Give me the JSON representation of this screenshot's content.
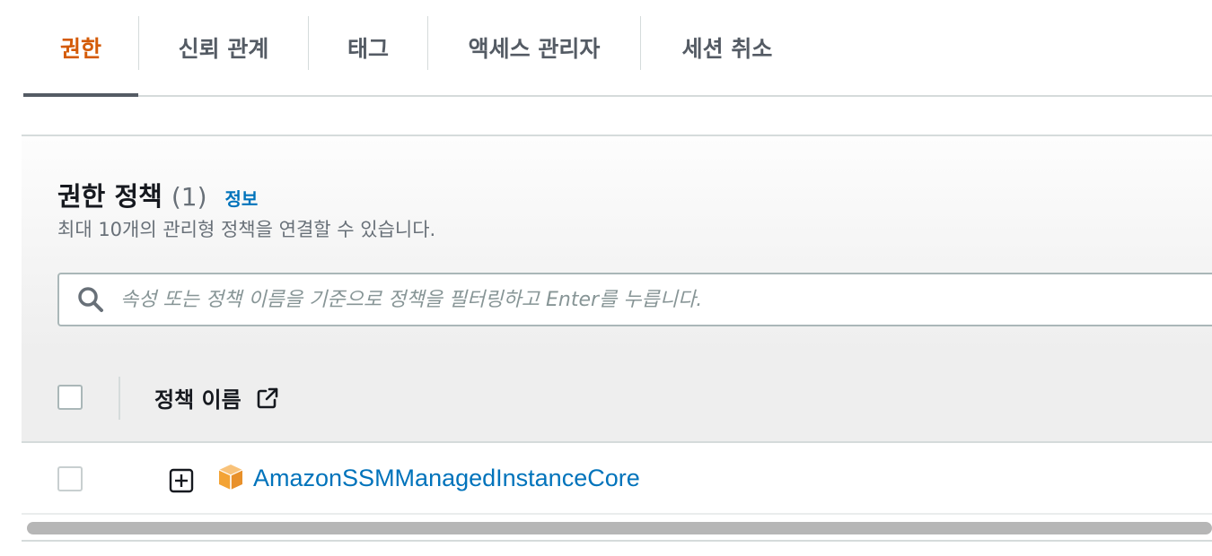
{
  "tabs": [
    {
      "label": "권한",
      "active": true
    },
    {
      "label": "신뢰 관계",
      "active": false
    },
    {
      "label": "태그",
      "active": false
    },
    {
      "label": "액세스 관리자",
      "active": false
    },
    {
      "label": "세션 취소",
      "active": false
    }
  ],
  "panel": {
    "title": "권한 정책",
    "count": "(1)",
    "info_link": "정보",
    "description": "최대 10개의 관리형 정책을 연결할 수 있습니다.",
    "search": {
      "placeholder": "속성 또는 정책 이름을 기준으로 정책을 필터링하고 Enter를 누릅니다.",
      "value": "",
      "icon": "search-icon"
    }
  },
  "table": {
    "columns": [
      {
        "label": "정책 이름",
        "icon": "external-link-icon"
      }
    ],
    "rows": [
      {
        "policy_name": "AmazonSSMManagedInstanceCore",
        "policy_icon": "aws-managed-policy-cube-icon",
        "expand_icon": "plus-square-icon",
        "selected": false
      }
    ],
    "header_checkbox_checked": false
  },
  "colors": {
    "active_tab": "#d45b07",
    "tab_text": "#545b64",
    "link": "#0073bb",
    "muted_text": "#687078",
    "policy_icon": "#f3a335"
  }
}
